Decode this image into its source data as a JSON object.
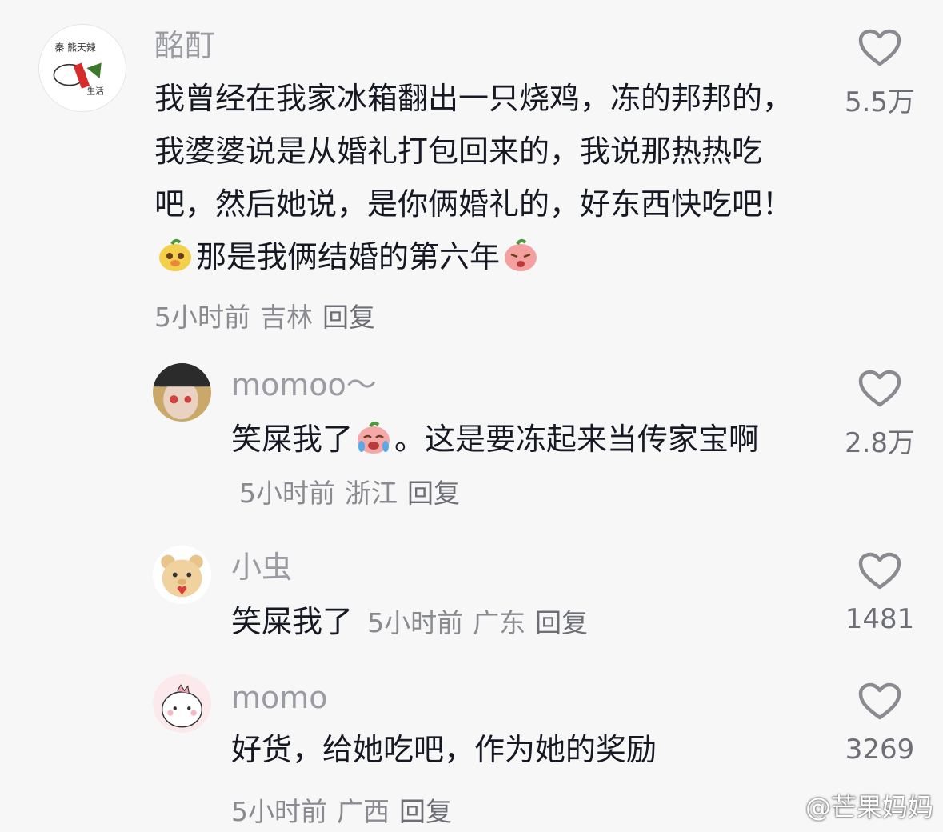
{
  "comments": [
    {
      "username": "酩酊",
      "text_part1": "我曾经在我家冰箱翻出一只烧鸡，冻的邦邦的，我婆婆说是从婚礼打包回来的，我说那热热吃吧，然后她说，是你俩婚礼的，好东西快吃吧！",
      "text_part2": "那是我俩结婚的第六年",
      "time": "5小时前",
      "location": "吉林",
      "reply": "回复",
      "likes": "5.5万"
    },
    {
      "username": "momoo～",
      "text_part1": "笑屎我了",
      "text_part2": "。这是要冻起来当传家宝啊",
      "time": "5小时前",
      "location": "浙江",
      "reply": "回复",
      "likes": "2.8万"
    },
    {
      "username": "小虫",
      "text_part1": "笑屎我了",
      "time": "5小时前",
      "location": "广东",
      "reply": "回复",
      "likes": "1481"
    },
    {
      "username": "momo",
      "text_part1": "好货，给她吃吧，作为她的奖励",
      "time": "5小时前",
      "location": "广西",
      "reply": "回复",
      "likes": "3269"
    }
  ],
  "watermark": "@芒果妈妈",
  "colors": {
    "text": "#161823",
    "meta": "#8a8b91",
    "username": "#9b9ca3",
    "background": "#f7f7f7"
  }
}
